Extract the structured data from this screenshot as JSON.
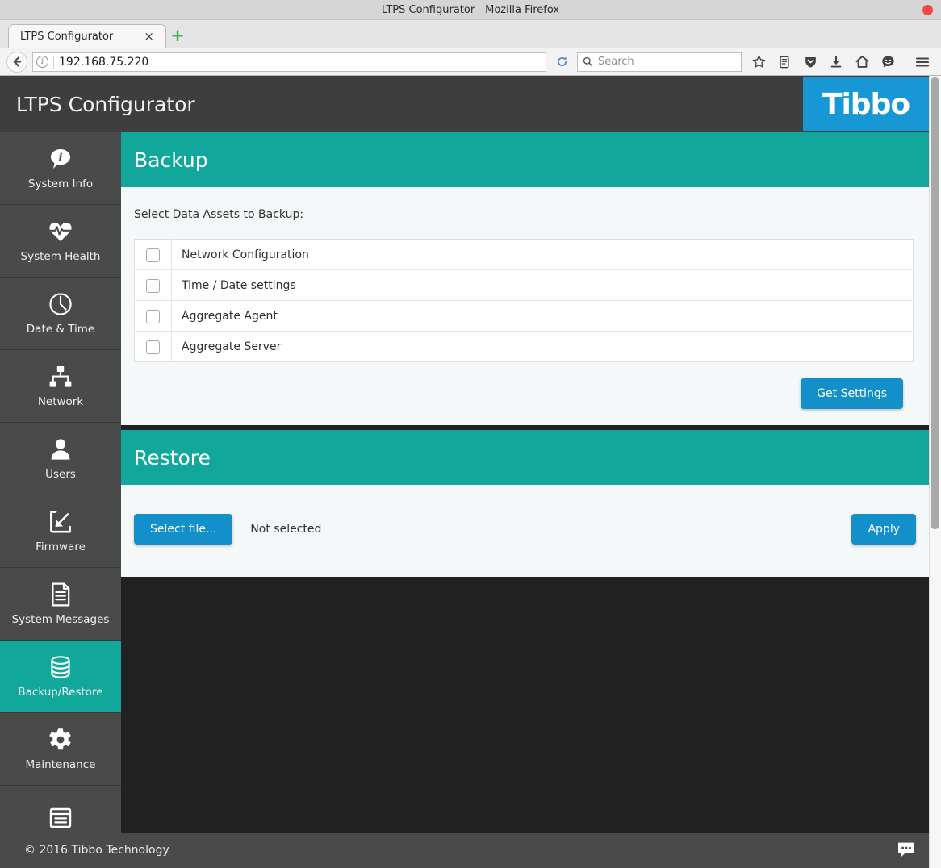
{
  "browser": {
    "window_title": "LTPS Configurator - Mozilla Firefox",
    "tab_label": "LTPS Configurator",
    "tab_close_label": "×",
    "new_tab_label": "+",
    "url": "192.168.75.220",
    "search_placeholder": "Search",
    "icons": {
      "back": "back-arrow-icon",
      "info": "site-info-icon",
      "reload": "reload-icon",
      "search": "search-icon",
      "bookmark": "star-icon",
      "library": "library-icon",
      "pocket": "pocket-shield-icon",
      "downloads": "download-arrow-icon",
      "home": "home-icon",
      "sync": "sync-smiley-icon",
      "menu": "hamburger-menu-icon"
    }
  },
  "app": {
    "title": "LTPS Configurator",
    "brand": "Tibbo"
  },
  "colors": {
    "teal": "#11a79b",
    "blue": "#1390ca",
    "brand_blue": "#1797d4",
    "sidebar": "#4a4a4a",
    "header": "#3e3e3e"
  },
  "sidebar": {
    "items": [
      {
        "label": "System Info",
        "icon": "info-bubble-icon",
        "active": false
      },
      {
        "label": "System Health",
        "icon": "heartbeat-icon",
        "active": false
      },
      {
        "label": "Date & Time",
        "icon": "clock-icon",
        "active": false
      },
      {
        "label": "Network",
        "icon": "network-tree-icon",
        "active": false
      },
      {
        "label": "Users",
        "icon": "user-icon",
        "active": false
      },
      {
        "label": "Firmware",
        "icon": "firmware-icon",
        "active": false
      },
      {
        "label": "System Messages",
        "icon": "document-icon",
        "active": false
      },
      {
        "label": "Backup/Restore",
        "icon": "database-icon",
        "active": true
      },
      {
        "label": "Maintenance",
        "icon": "gear-icon",
        "active": false
      },
      {
        "label": "",
        "icon": "server-list-icon",
        "active": false
      }
    ]
  },
  "backup": {
    "title": "Backup",
    "select_label": "Select Data Assets to Backup:",
    "assets": [
      {
        "name": "Network Configuration",
        "checked": false
      },
      {
        "name": "Time / Date settings",
        "checked": false
      },
      {
        "name": "Aggregate Agent",
        "checked": false
      },
      {
        "name": "Aggregate Server",
        "checked": false
      }
    ],
    "get_settings_label": "Get Settings"
  },
  "restore": {
    "title": "Restore",
    "select_file_label": "Select file...",
    "file_status": "Not selected",
    "apply_label": "Apply"
  },
  "footer": {
    "copyright": "© 2016 Tibbo Technology",
    "chat_icon": "chat-bubble-icon"
  }
}
